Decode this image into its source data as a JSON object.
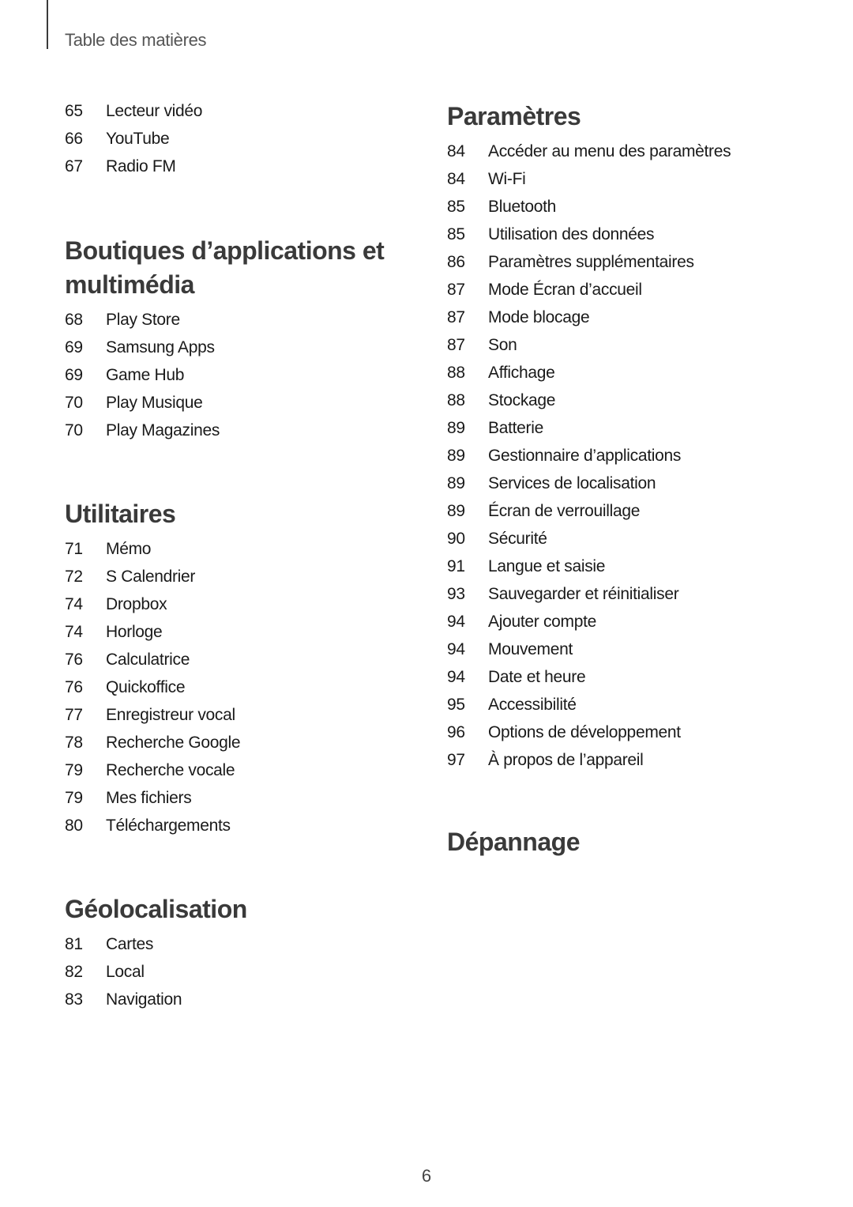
{
  "header": {
    "title": "Table des matières"
  },
  "left_column": {
    "intro_entries": [
      {
        "page": "65",
        "label": "Lecteur vidéo"
      },
      {
        "page": "66",
        "label": "YouTube"
      },
      {
        "page": "67",
        "label": "Radio FM"
      }
    ],
    "sections": [
      {
        "title_line1": "Boutiques d’applications et",
        "title_line2": "multimédia",
        "entries": [
          {
            "page": "68",
            "label": "Play Store"
          },
          {
            "page": "69",
            "label": "Samsung Apps"
          },
          {
            "page": "69",
            "label": "Game Hub"
          },
          {
            "page": "70",
            "label": "Play Musique"
          },
          {
            "page": "70",
            "label": "Play Magazines"
          }
        ]
      },
      {
        "title": "Utilitaires",
        "entries": [
          {
            "page": "71",
            "label": "Mémo"
          },
          {
            "page": "72",
            "label": "S Calendrier"
          },
          {
            "page": "74",
            "label": "Dropbox"
          },
          {
            "page": "74",
            "label": "Horloge"
          },
          {
            "page": "76",
            "label": "Calculatrice"
          },
          {
            "page": "76",
            "label": "Quickoffice"
          },
          {
            "page": "77",
            "label": "Enregistreur vocal"
          },
          {
            "page": "78",
            "label": "Recherche Google"
          },
          {
            "page": "79",
            "label": "Recherche vocale"
          },
          {
            "page": "79",
            "label": "Mes fichiers"
          },
          {
            "page": "80",
            "label": "Téléchargements"
          }
        ]
      },
      {
        "title": "Géolocalisation",
        "entries": [
          {
            "page": "81",
            "label": "Cartes"
          },
          {
            "page": "82",
            "label": "Local"
          },
          {
            "page": "83",
            "label": "Navigation"
          }
        ]
      }
    ]
  },
  "right_column": {
    "sections": [
      {
        "title": "Paramètres",
        "entries": [
          {
            "page": "84",
            "label": "Accéder au menu des paramètres"
          },
          {
            "page": "84",
            "label": "Wi-Fi"
          },
          {
            "page": "85",
            "label": "Bluetooth"
          },
          {
            "page": "85",
            "label": "Utilisation des données"
          },
          {
            "page": "86",
            "label": "Paramètres supplémentaires"
          },
          {
            "page": "87",
            "label": "Mode Écran d’accueil"
          },
          {
            "page": "87",
            "label": "Mode blocage"
          },
          {
            "page": "87",
            "label": "Son"
          },
          {
            "page": "88",
            "label": "Affichage"
          },
          {
            "page": "88",
            "label": "Stockage"
          },
          {
            "page": "89",
            "label": "Batterie"
          },
          {
            "page": "89",
            "label": "Gestionnaire d’applications"
          },
          {
            "page": "89",
            "label": "Services de localisation"
          },
          {
            "page": "89",
            "label": "Écran de verrouillage"
          },
          {
            "page": "90",
            "label": "Sécurité"
          },
          {
            "page": "91",
            "label": "Langue et saisie"
          },
          {
            "page": "93",
            "label": "Sauvegarder et réinitialiser"
          },
          {
            "page": "94",
            "label": "Ajouter compte"
          },
          {
            "page": "94",
            "label": "Mouvement"
          },
          {
            "page": "94",
            "label": "Date et heure"
          },
          {
            "page": "95",
            "label": "Accessibilité"
          },
          {
            "page": "96",
            "label": "Options de développement"
          },
          {
            "page": "97",
            "label": "À propos de l’appareil"
          }
        ]
      },
      {
        "title": "Dépannage",
        "entries": []
      }
    ]
  },
  "footer": {
    "page_number": "6"
  }
}
